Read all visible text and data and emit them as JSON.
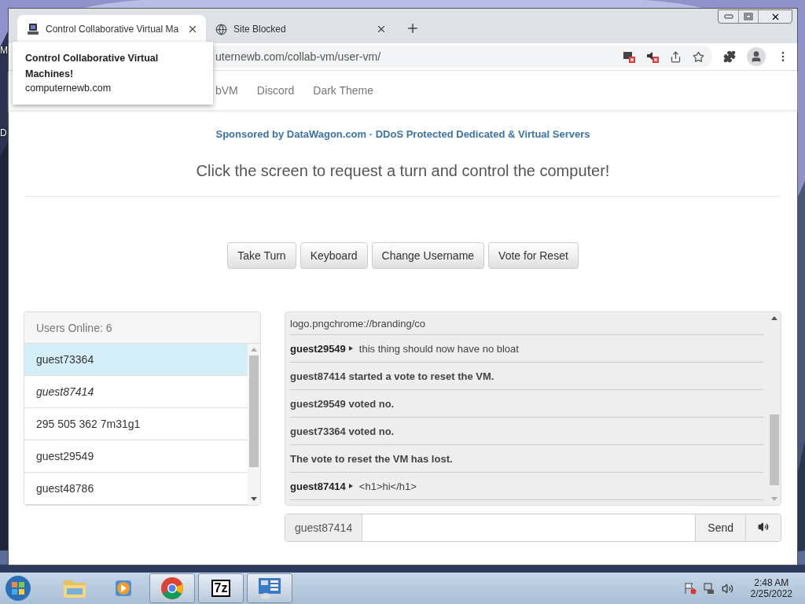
{
  "desktop": {
    "icon_labels": [
      "M",
      "D"
    ]
  },
  "browser": {
    "tabs": [
      {
        "title": "Control Collaborative Virtual Ma",
        "selected": true
      },
      {
        "title": "Site Blocked",
        "selected": false
      }
    ],
    "address": "uternewb.com/collab-vm/user-vm/",
    "tooltip": {
      "title": "Control Collaborative Virtual Machines!",
      "domain": "computernewb.com"
    }
  },
  "page": {
    "nav": [
      "bVM",
      "Discord",
      "Dark Theme"
    ],
    "sponsor": "Sponsored by DataWagon.com · DDoS Protected Dedicated & Virtual Servers",
    "heading": "Click the screen to request a turn and control the computer!",
    "buttons": [
      "Take Turn",
      "Keyboard",
      "Change Username",
      "Vote for Reset"
    ],
    "users_header": "Users Online: 6",
    "users": [
      {
        "name": "guest73364",
        "selected": true,
        "self": false
      },
      {
        "name": "guest87414",
        "selected": false,
        "self": true
      },
      {
        "name": "295 505 362 7m31g1",
        "selected": false,
        "self": false
      },
      {
        "name": "guest29549",
        "selected": false,
        "self": false
      },
      {
        "name": "guest48786",
        "selected": false,
        "self": false
      }
    ],
    "chat": [
      {
        "kind": "plain",
        "text": "logo.pngchrome://branding/co"
      },
      {
        "kind": "chat",
        "user": "guest29549",
        "text": "this thing should now have no bloat"
      },
      {
        "kind": "system",
        "text": "guest87414 started a vote to reset the VM."
      },
      {
        "kind": "system",
        "text": "guest29549 voted no."
      },
      {
        "kind": "system",
        "text": "guest73364 voted no."
      },
      {
        "kind": "system",
        "text": "The vote to reset the VM has lost."
      },
      {
        "kind": "chat",
        "user": "guest87414",
        "text": "<h1>hi</h1>"
      }
    ],
    "chat_username": "guest87414",
    "send": "Send"
  },
  "taskbar": {
    "apps": [
      {
        "kind": "folder",
        "selected": false
      },
      {
        "kind": "media",
        "selected": false
      },
      {
        "kind": "chrome",
        "selected": true
      },
      {
        "kind": "zip",
        "selected": true,
        "label": "7z"
      },
      {
        "kind": "panel",
        "selected": true
      }
    ],
    "time": "2:48 AM",
    "date": "2/25/2022"
  }
}
